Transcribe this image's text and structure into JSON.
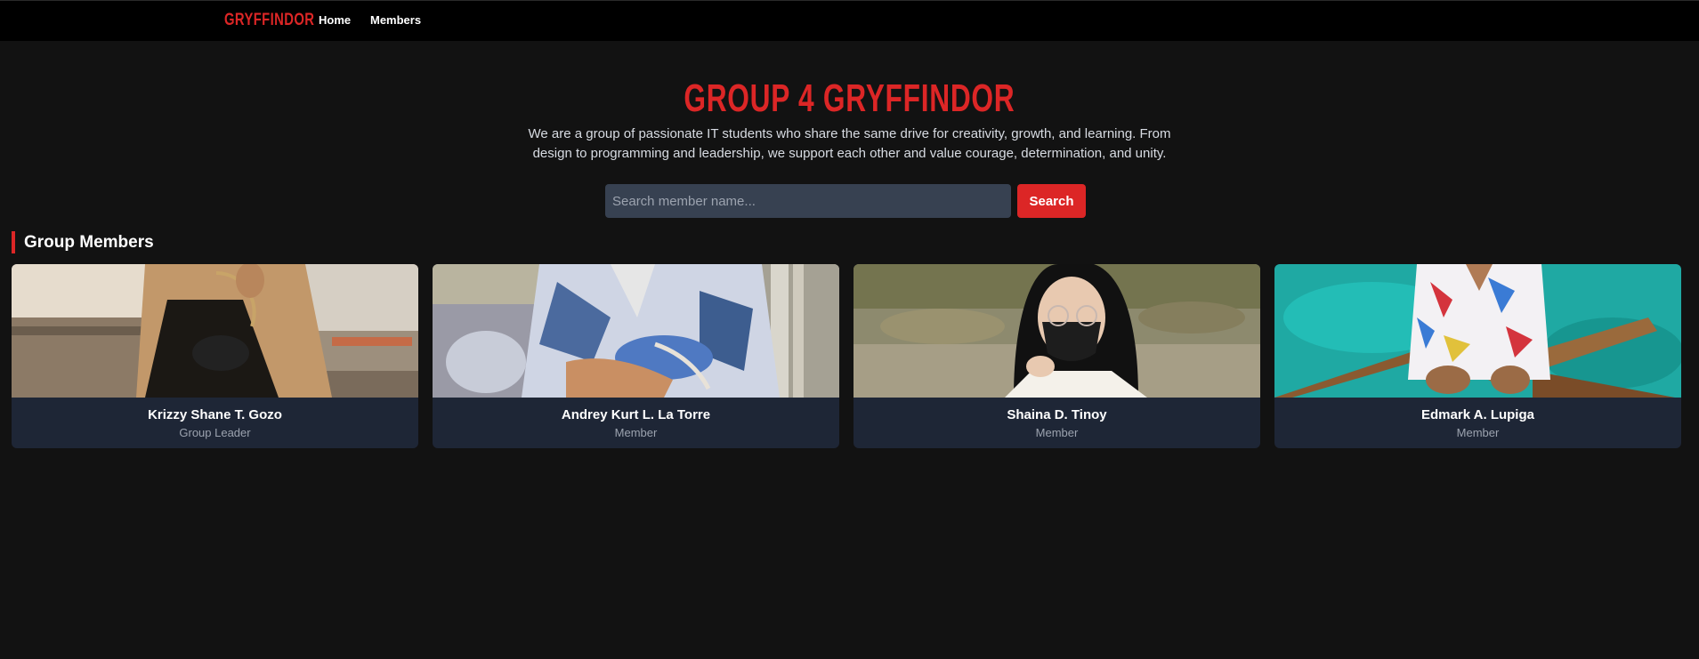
{
  "nav": {
    "brand": "GRYFFINDOR",
    "links": [
      "Home",
      "Members"
    ]
  },
  "hero": {
    "title": "GROUP 4 GRYFFINDOR",
    "description": "We are a group of passionate IT students who share the same drive for creativity, growth, and learning. From design to programming and leadership, we support each other and value courage, determination, and unity."
  },
  "search": {
    "placeholder": "Search member name...",
    "value": "",
    "button_label": "Search"
  },
  "members_section": {
    "title": "Group Members",
    "members": [
      {
        "name": "Krizzy Shane T. Gozo",
        "role": "Group Leader"
      },
      {
        "name": "Andrey Kurt L. La Torre",
        "role": "Member"
      },
      {
        "name": "Shaina D. Tinoy",
        "role": "Member"
      },
      {
        "name": "Edmark A. Lupiga",
        "role": "Member"
      }
    ]
  },
  "colors": {
    "accent": "#dc2626",
    "background": "#121212",
    "navbar": "#000000",
    "card": "#1e2636",
    "input": "#374151"
  }
}
